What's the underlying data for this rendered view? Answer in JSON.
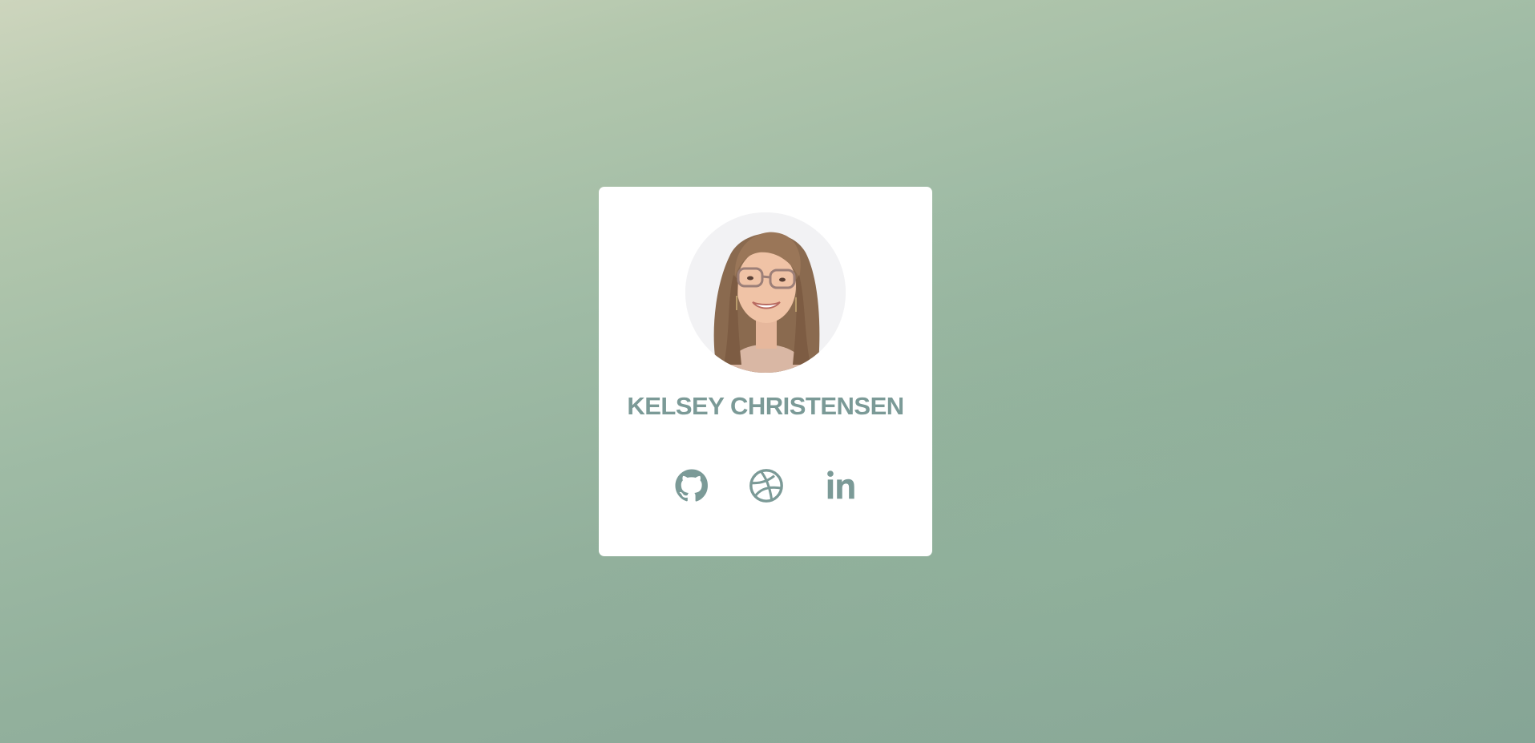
{
  "profile": {
    "name": "KELSEY CHRISTENSEN",
    "avatar_icon": "profile-photo"
  },
  "socials": [
    {
      "icon": "github-icon"
    },
    {
      "icon": "dribbble-icon"
    },
    {
      "icon": "linkedin-icon"
    }
  ],
  "colors": {
    "accent": "#7b9a97",
    "card": "#ffffff",
    "background_top": "#cdd5bd",
    "background_bottom": "#86a596"
  }
}
